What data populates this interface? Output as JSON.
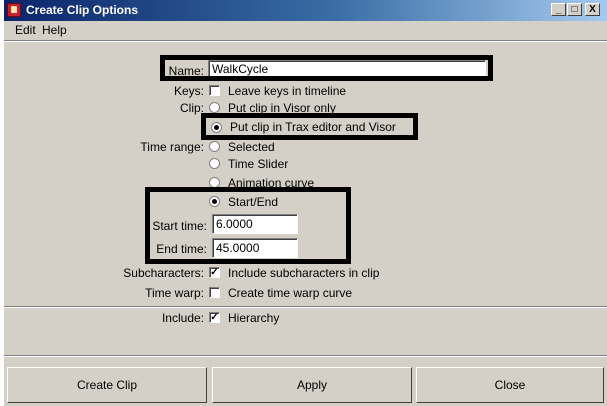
{
  "window": {
    "title": "Create Clip Options",
    "controls": {
      "minimize": "_",
      "maximize": "□",
      "close": "X"
    }
  },
  "menu": [
    "Edit",
    "Help"
  ],
  "form": {
    "name": {
      "label": "Name:",
      "value": "WalkCycle"
    },
    "keys": {
      "label": "Keys:",
      "option": "Leave keys in timeline",
      "checked": false
    },
    "clip": {
      "label": "Clip:",
      "options": [
        {
          "text": "Put clip in Visor only",
          "selected": false
        },
        {
          "text": "Put clip in Trax editor and Visor",
          "selected": true
        }
      ]
    },
    "time_range": {
      "label": "Time range:",
      "options": [
        {
          "text": "Selected",
          "selected": false
        },
        {
          "text": "Time Slider",
          "selected": false
        },
        {
          "text": "Animation curve",
          "selected": false
        },
        {
          "text": "Start/End",
          "selected": true
        }
      ]
    },
    "start_time": {
      "label": "Start time:",
      "value": "6.0000"
    },
    "end_time": {
      "label": "End time:",
      "value": "45.0000"
    },
    "subcharacters": {
      "label": "Subcharacters:",
      "option": "Include subcharacters in clip",
      "checked": true
    },
    "time_warp": {
      "label": "Time warp:",
      "option": "Create time warp curve",
      "checked": false
    },
    "include": {
      "label": "Include:",
      "option": "Hierarchy",
      "checked": true
    }
  },
  "buttons": {
    "create": "Create Clip",
    "apply": "Apply",
    "close": "Close"
  },
  "check_glyph": "✓",
  "highlight_color": "#000000"
}
